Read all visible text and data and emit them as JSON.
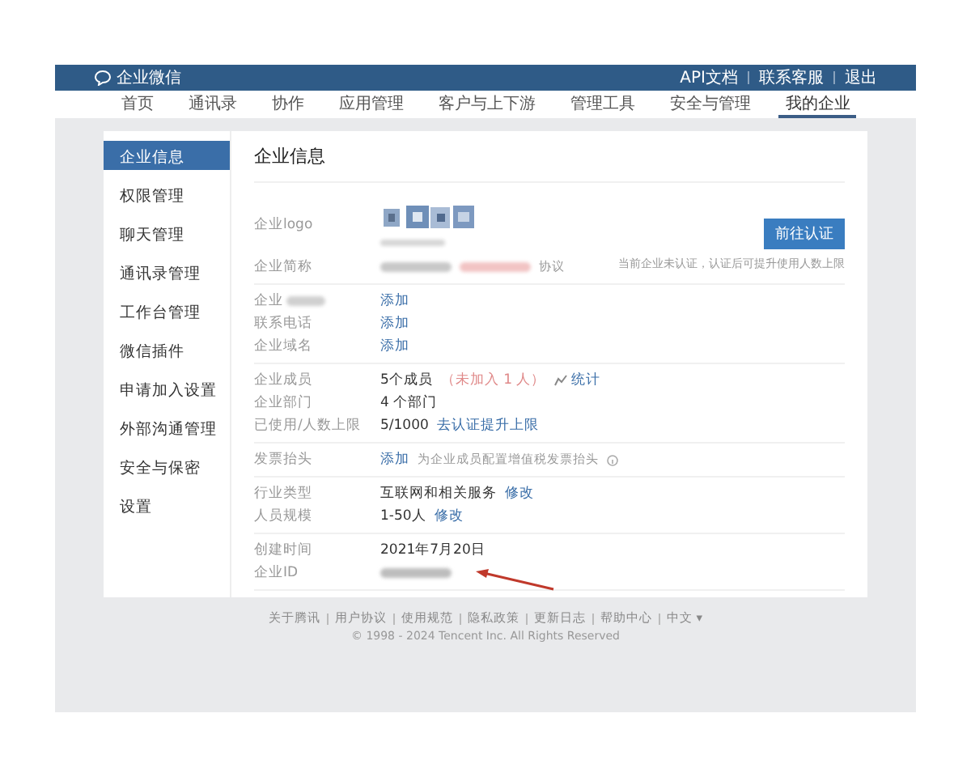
{
  "topbar": {
    "logo_text": "企业微信",
    "links": [
      "API文档",
      "联系客服",
      "退出"
    ]
  },
  "nav": [
    {
      "label": "首页",
      "selected": false
    },
    {
      "label": "通讯录",
      "selected": false
    },
    {
      "label": "协作",
      "selected": false
    },
    {
      "label": "应用管理",
      "selected": false
    },
    {
      "label": "客户与上下游",
      "selected": false
    },
    {
      "label": "管理工具",
      "selected": false
    },
    {
      "label": "安全与管理",
      "selected": false
    },
    {
      "label": "我的企业",
      "selected": true
    }
  ],
  "sidebar": [
    {
      "label": "企业信息",
      "selected": true
    },
    {
      "label": "权限管理",
      "selected": false
    },
    {
      "label": "聊天管理",
      "selected": false
    },
    {
      "label": "通讯录管理",
      "selected": false
    },
    {
      "label": "工作台管理",
      "selected": false
    },
    {
      "label": "微信插件",
      "selected": false
    },
    {
      "label": "申请加入设置",
      "selected": false
    },
    {
      "label": "外部沟通管理",
      "selected": false
    },
    {
      "label": "安全与保密",
      "selected": false
    },
    {
      "label": "设置",
      "selected": false
    }
  ],
  "panel": {
    "title": "企业信息",
    "verify_button": "前往认证",
    "verify_note": "当前企业未认证，认证后可提升使用人数上限",
    "groups": [
      {
        "rows": [
          {
            "label": "企业logo",
            "label_blurred": false,
            "parts": [
              {
                "kind": "logo"
              }
            ]
          },
          {
            "label": "企业简称",
            "label_blurred": false,
            "parts": [
              {
                "kind": "blur",
                "color": "#c8c8c8"
              },
              {
                "kind": "blur",
                "color": "#f2c4c4"
              },
              {
                "kind": "muted",
                "text": "协议"
              }
            ]
          }
        ]
      },
      {
        "rows": [
          {
            "label": "企业",
            "label_blurred": true,
            "parts": [
              {
                "kind": "link",
                "text": "添加"
              }
            ]
          },
          {
            "label": "联系电话",
            "label_blurred": false,
            "parts": [
              {
                "kind": "link",
                "text": "添加"
              }
            ]
          },
          {
            "label": "企业域名",
            "label_blurred": false,
            "parts": [
              {
                "kind": "link",
                "text": "添加"
              }
            ]
          }
        ]
      },
      {
        "rows": [
          {
            "label": "企业成员",
            "label_blurred": false,
            "parts": [
              {
                "kind": "value",
                "text": "5个成员"
              },
              {
                "kind": "alert",
                "text": "（未加入 1 人）"
              },
              {
                "kind": "stat",
                "text": "统计"
              }
            ]
          },
          {
            "label": "企业部门",
            "label_blurred": false,
            "parts": [
              {
                "kind": "value",
                "text": "4 个部门"
              }
            ]
          },
          {
            "label": "已使用/人数上限",
            "label_blurred": false,
            "parts": [
              {
                "kind": "value",
                "text": "5/1000"
              },
              {
                "kind": "link",
                "text": "去认证提升上限"
              }
            ]
          }
        ]
      },
      {
        "rows": [
          {
            "label": "发票抬头",
            "label_blurred": false,
            "parts": [
              {
                "kind": "link",
                "text": "添加"
              },
              {
                "kind": "note",
                "text": "为企业成员配置增值税发票抬头"
              },
              {
                "kind": "info"
              }
            ]
          }
        ]
      },
      {
        "rows": [
          {
            "label": "行业类型",
            "label_blurred": false,
            "parts": [
              {
                "kind": "value",
                "text": "互联网和相关服务"
              },
              {
                "kind": "link",
                "text": "修改"
              }
            ]
          },
          {
            "label": "人员规模",
            "label_blurred": false,
            "parts": [
              {
                "kind": "value",
                "text": "1-50人"
              },
              {
                "kind": "link",
                "text": "修改"
              }
            ]
          }
        ]
      },
      {
        "rows": [
          {
            "label": "创建时间",
            "label_blurred": false,
            "parts": [
              {
                "kind": "value",
                "text": "2021年7月20日"
              }
            ]
          },
          {
            "label": "企业ID",
            "label_blurred": false,
            "parts": [
              {
                "kind": "blur",
                "color": "#bdbdbd"
              }
            ]
          }
        ]
      }
    ]
  },
  "footer": {
    "links": [
      "关于腾讯",
      "用户协议",
      "使用规范",
      "隐私政策",
      "更新日志",
      "帮助中心",
      "中文 ▾"
    ],
    "copyright": "© 1998 - 2024 Tencent Inc. All Rights Reserved"
  }
}
